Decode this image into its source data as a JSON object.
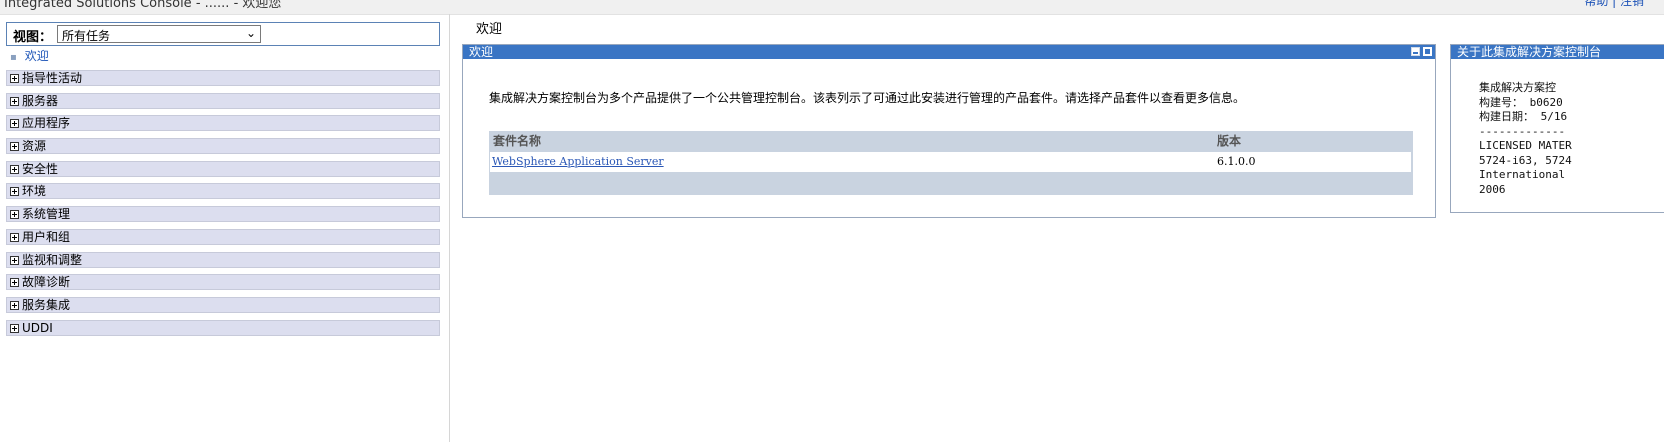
{
  "window": {
    "title": "Integrated Solutions Console - ...... - 欢迎您",
    "top_right": "帮助 | 注销"
  },
  "nav": {
    "view_label": "视图：",
    "view_select_value": "所有任务",
    "welcome_link": "欢迎",
    "items": [
      {
        "label": "指导性活动"
      },
      {
        "label": "服务器"
      },
      {
        "label": "应用程序"
      },
      {
        "label": "资源"
      },
      {
        "label": "安全性"
      },
      {
        "label": "环境"
      },
      {
        "label": "系统管理"
      },
      {
        "label": "用户和组"
      },
      {
        "label": "监视和调整"
      },
      {
        "label": "故障诊断"
      },
      {
        "label": "服务集成"
      },
      {
        "label": "UDDI"
      }
    ]
  },
  "main": {
    "page_title": "欢迎",
    "portlet_title": "欢迎",
    "description": "集成解决方案控制台为多个产品提供了一个公共管理控制台。该表列示了可通过此安装进行管理的产品套件。请选择产品套件以查看更多信息。",
    "table": {
      "headers": [
        "套件名称",
        "版本"
      ],
      "rows": [
        {
          "name": "WebSphere Application Server",
          "version": "6.1.0.0"
        }
      ]
    }
  },
  "about": {
    "title": "关于此集成解决方案控制台",
    "lines": [
      "集成解决方案控",
      "构建号： b0620",
      "构建日期： 5/16",
      "-------------",
      "LICENSED MATER",
      "5724-i63, 5724",
      "International ",
      "2006"
    ]
  },
  "colors": {
    "titlebar": "#3a75c4",
    "nav_item_bg": "#dcdeef",
    "table_header_bg": "#c9d3e0",
    "link": "#2a57b6"
  }
}
